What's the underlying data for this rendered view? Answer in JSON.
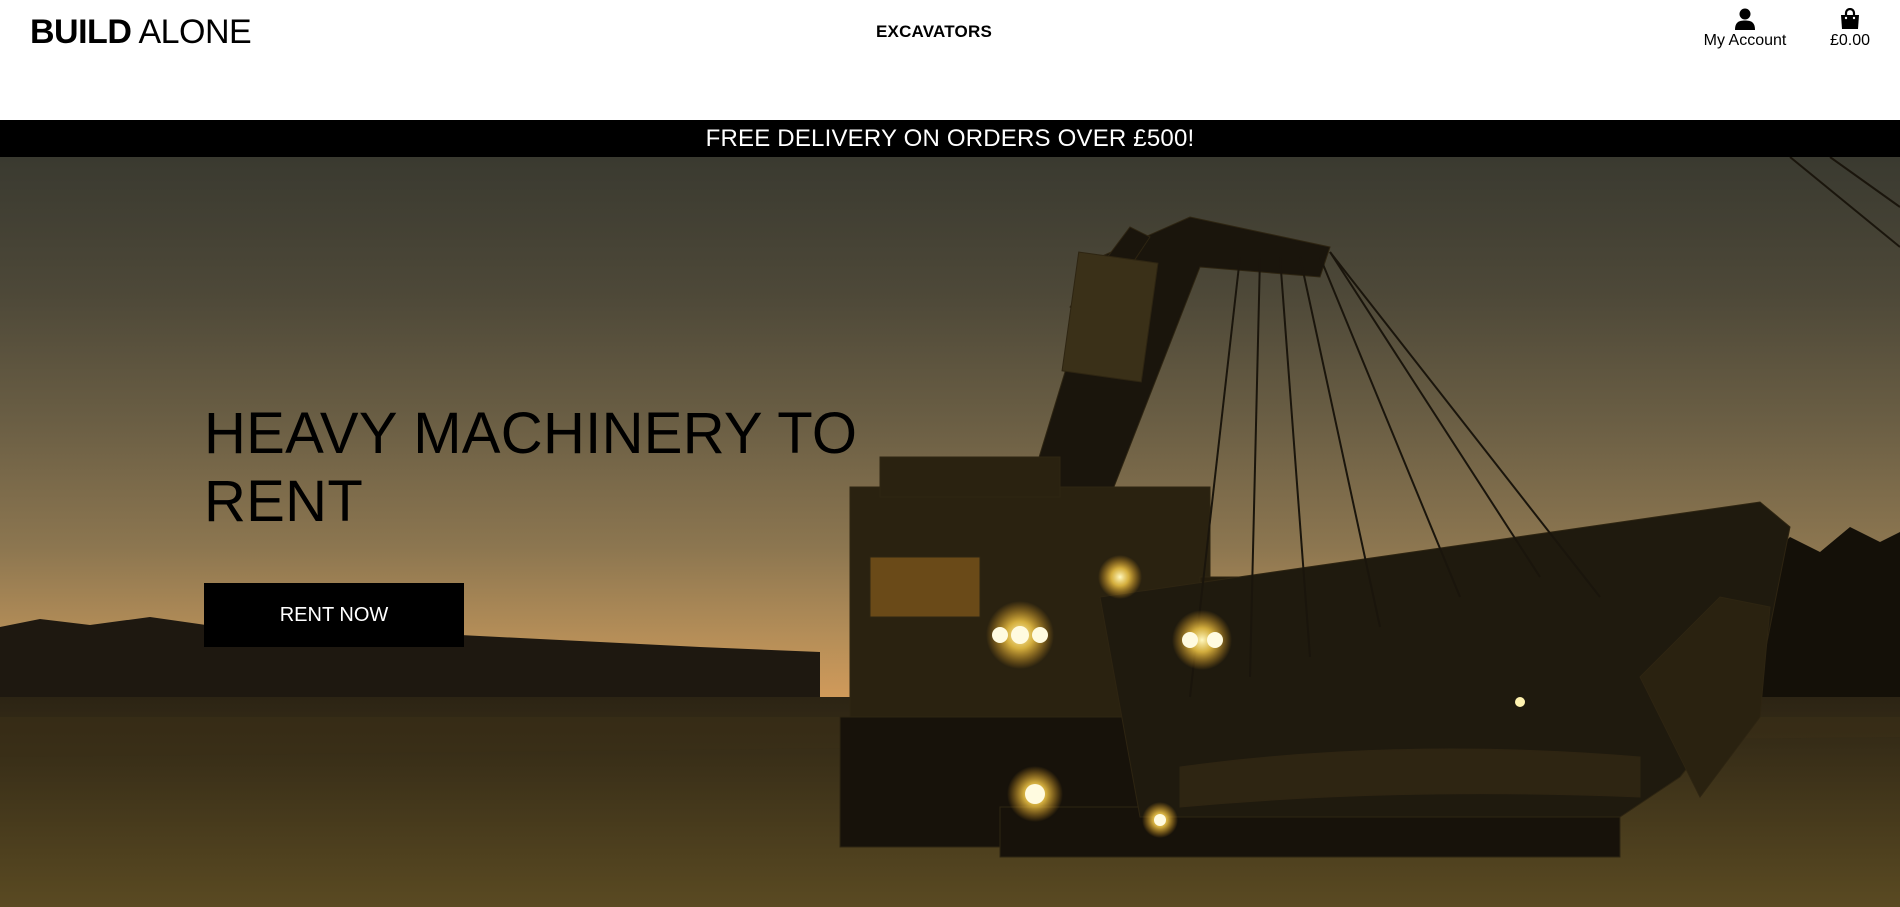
{
  "header": {
    "logo_bold": "BUILD",
    "logo_light": "ALONE",
    "nav": [
      {
        "label": "EXCAVATORS"
      }
    ],
    "account_label": "My Account",
    "account_icon": "user-icon",
    "bag_total": "£0.00",
    "bag_icon": "shopping-bag-icon"
  },
  "banner": {
    "text": "FREE DELIVERY ON ORDERS OVER £500!"
  },
  "hero": {
    "title": "HEAVY MACHINERY TO RENT",
    "button_label": "RENT NOW"
  },
  "colors": {
    "banner_bg": "#000000",
    "button_bg": "#000000",
    "light_glow": "#ffe070"
  }
}
